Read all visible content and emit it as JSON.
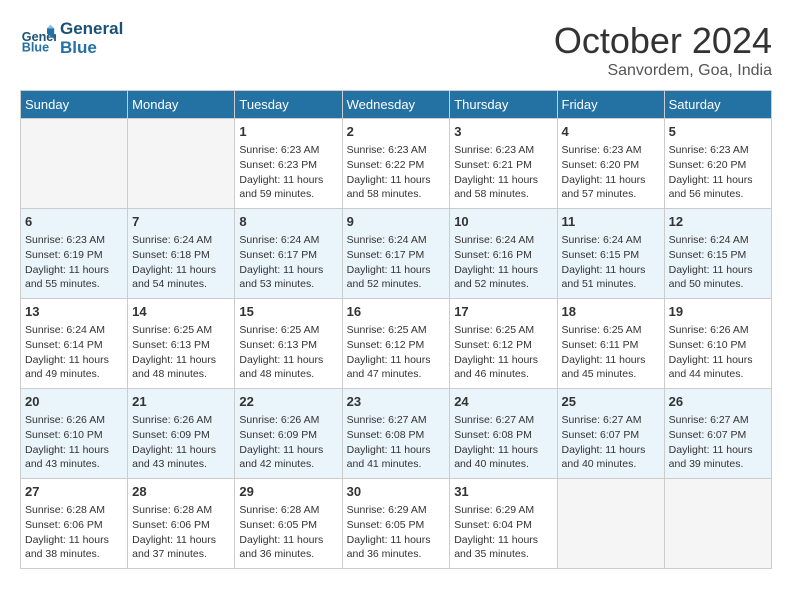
{
  "header": {
    "logo_line1": "General",
    "logo_line2": "Blue",
    "month": "October 2024",
    "location": "Sanvordem, Goa, India"
  },
  "days_of_week": [
    "Sunday",
    "Monday",
    "Tuesday",
    "Wednesday",
    "Thursday",
    "Friday",
    "Saturday"
  ],
  "weeks": [
    [
      {
        "day": "",
        "empty": true
      },
      {
        "day": "",
        "empty": true
      },
      {
        "day": "1",
        "sunrise": "6:23 AM",
        "sunset": "6:23 PM",
        "daylight": "11 hours and 59 minutes."
      },
      {
        "day": "2",
        "sunrise": "6:23 AM",
        "sunset": "6:22 PM",
        "daylight": "11 hours and 58 minutes."
      },
      {
        "day": "3",
        "sunrise": "6:23 AM",
        "sunset": "6:21 PM",
        "daylight": "11 hours and 58 minutes."
      },
      {
        "day": "4",
        "sunrise": "6:23 AM",
        "sunset": "6:20 PM",
        "daylight": "11 hours and 57 minutes."
      },
      {
        "day": "5",
        "sunrise": "6:23 AM",
        "sunset": "6:20 PM",
        "daylight": "11 hours and 56 minutes."
      }
    ],
    [
      {
        "day": "6",
        "sunrise": "6:23 AM",
        "sunset": "6:19 PM",
        "daylight": "11 hours and 55 minutes."
      },
      {
        "day": "7",
        "sunrise": "6:24 AM",
        "sunset": "6:18 PM",
        "daylight": "11 hours and 54 minutes."
      },
      {
        "day": "8",
        "sunrise": "6:24 AM",
        "sunset": "6:17 PM",
        "daylight": "11 hours and 53 minutes."
      },
      {
        "day": "9",
        "sunrise": "6:24 AM",
        "sunset": "6:17 PM",
        "daylight": "11 hours and 52 minutes."
      },
      {
        "day": "10",
        "sunrise": "6:24 AM",
        "sunset": "6:16 PM",
        "daylight": "11 hours and 52 minutes."
      },
      {
        "day": "11",
        "sunrise": "6:24 AM",
        "sunset": "6:15 PM",
        "daylight": "11 hours and 51 minutes."
      },
      {
        "day": "12",
        "sunrise": "6:24 AM",
        "sunset": "6:15 PM",
        "daylight": "11 hours and 50 minutes."
      }
    ],
    [
      {
        "day": "13",
        "sunrise": "6:24 AM",
        "sunset": "6:14 PM",
        "daylight": "11 hours and 49 minutes."
      },
      {
        "day": "14",
        "sunrise": "6:25 AM",
        "sunset": "6:13 PM",
        "daylight": "11 hours and 48 minutes."
      },
      {
        "day": "15",
        "sunrise": "6:25 AM",
        "sunset": "6:13 PM",
        "daylight": "11 hours and 48 minutes."
      },
      {
        "day": "16",
        "sunrise": "6:25 AM",
        "sunset": "6:12 PM",
        "daylight": "11 hours and 47 minutes."
      },
      {
        "day": "17",
        "sunrise": "6:25 AM",
        "sunset": "6:12 PM",
        "daylight": "11 hours and 46 minutes."
      },
      {
        "day": "18",
        "sunrise": "6:25 AM",
        "sunset": "6:11 PM",
        "daylight": "11 hours and 45 minutes."
      },
      {
        "day": "19",
        "sunrise": "6:26 AM",
        "sunset": "6:10 PM",
        "daylight": "11 hours and 44 minutes."
      }
    ],
    [
      {
        "day": "20",
        "sunrise": "6:26 AM",
        "sunset": "6:10 PM",
        "daylight": "11 hours and 43 minutes."
      },
      {
        "day": "21",
        "sunrise": "6:26 AM",
        "sunset": "6:09 PM",
        "daylight": "11 hours and 43 minutes."
      },
      {
        "day": "22",
        "sunrise": "6:26 AM",
        "sunset": "6:09 PM",
        "daylight": "11 hours and 42 minutes."
      },
      {
        "day": "23",
        "sunrise": "6:27 AM",
        "sunset": "6:08 PM",
        "daylight": "11 hours and 41 minutes."
      },
      {
        "day": "24",
        "sunrise": "6:27 AM",
        "sunset": "6:08 PM",
        "daylight": "11 hours and 40 minutes."
      },
      {
        "day": "25",
        "sunrise": "6:27 AM",
        "sunset": "6:07 PM",
        "daylight": "11 hours and 40 minutes."
      },
      {
        "day": "26",
        "sunrise": "6:27 AM",
        "sunset": "6:07 PM",
        "daylight": "11 hours and 39 minutes."
      }
    ],
    [
      {
        "day": "27",
        "sunrise": "6:28 AM",
        "sunset": "6:06 PM",
        "daylight": "11 hours and 38 minutes."
      },
      {
        "day": "28",
        "sunrise": "6:28 AM",
        "sunset": "6:06 PM",
        "daylight": "11 hours and 37 minutes."
      },
      {
        "day": "29",
        "sunrise": "6:28 AM",
        "sunset": "6:05 PM",
        "daylight": "11 hours and 36 minutes."
      },
      {
        "day": "30",
        "sunrise": "6:29 AM",
        "sunset": "6:05 PM",
        "daylight": "11 hours and 36 minutes."
      },
      {
        "day": "31",
        "sunrise": "6:29 AM",
        "sunset": "6:04 PM",
        "daylight": "11 hours and 35 minutes."
      },
      {
        "day": "",
        "empty": true
      },
      {
        "day": "",
        "empty": true
      }
    ]
  ],
  "labels": {
    "sunrise_prefix": "Sunrise: ",
    "sunset_prefix": "Sunset: ",
    "daylight_prefix": "Daylight: "
  }
}
